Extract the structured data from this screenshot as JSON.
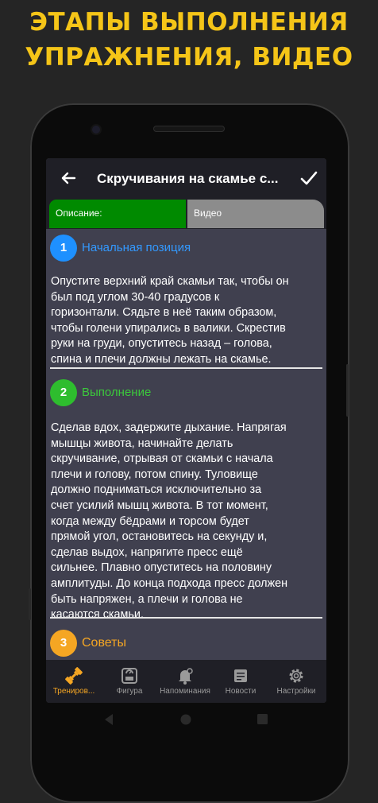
{
  "promo": {
    "line1": "ЭТАПЫ ВЫПОЛНЕНИЯ",
    "line2": "УПРАЖНЕНИЯ, ВИДЕО",
    "color": "#f5c518"
  },
  "app": {
    "title": "Скручивания на скамье с...",
    "tabs": [
      {
        "label": "Описание:",
        "active": true,
        "color": "#008a00"
      },
      {
        "label": "Видео",
        "active": false,
        "color": "#8c8c8c"
      }
    ],
    "sections": [
      {
        "number": "1",
        "title": "Начальная позиция",
        "color": "#1e90ff",
        "lines": [
          "Опустите верхний край скамьи так, чтобы он",
          "был под углом 30-40 градусов к",
          "горизонтали. Сядьте в неё таким образом,",
          "чтобы голени упирались в валики. Скрестив",
          "руки на груди, опуститесь назад – голова,",
          "спина и плечи должны лежать на скамье."
        ]
      },
      {
        "number": "2",
        "title": "Выполнение",
        "color": "#3cc83c",
        "lines": [
          "Сделав вдох, задержите дыхание. Напрягая",
          "мышцы живота, начинайте делать",
          "скручивание, отрывая от скамьи с начала",
          "плечи и голову, потом спину. Туловище",
          "должно подниматься исключительно за",
          "счет усилий мышц живота. В тот момент,",
          "когда между бёдрами и торсом будет",
          "прямой угол, остановитесь на секунду и,",
          "сделав выдох, напрягите пресс ещё",
          "сильнее. Плавно опуститесь на половину",
          "амплитуды. До конца подхода пресс должен",
          "быть напряжен, а плечи и голова не",
          "касаются скамьи."
        ]
      },
      {
        "number": "3",
        "title": "Советы",
        "color": "#f5a623"
      }
    ],
    "bottom_nav": [
      {
        "label": "Трениров...",
        "icon": "dumbbell-icon",
        "active": true
      },
      {
        "label": "Фигура",
        "icon": "scale-icon",
        "active": false
      },
      {
        "label": "Напоминания",
        "icon": "bell-icon",
        "active": false
      },
      {
        "label": "Новости",
        "icon": "news-icon",
        "active": false
      },
      {
        "label": "Настройки",
        "icon": "gear-icon",
        "active": false
      }
    ],
    "accent_color": "#f5a623"
  }
}
